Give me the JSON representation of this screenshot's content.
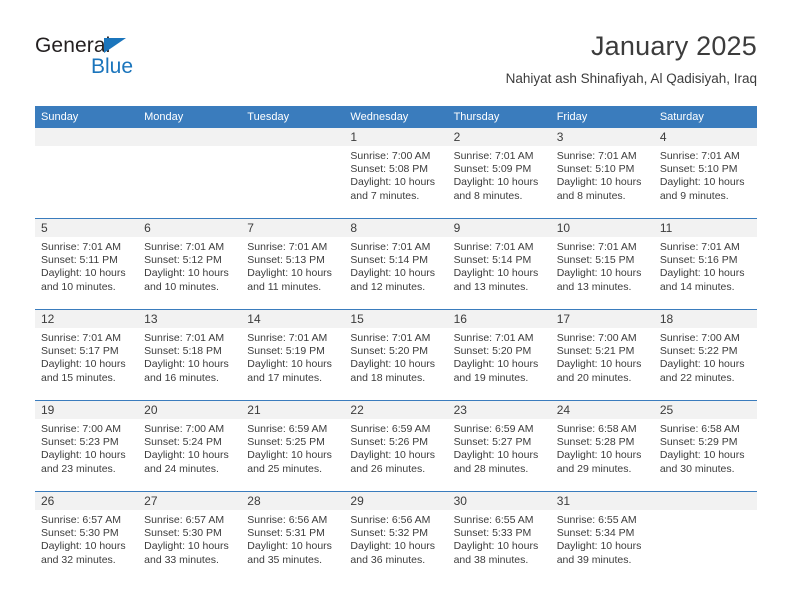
{
  "brand": {
    "name_dark": "General",
    "name_blue": "Blue",
    "accent_color": "#1b75bc"
  },
  "header": {
    "title": "January 2025",
    "subtitle": "Nahiyat ash Shinafiyah, Al Qadisiyah, Iraq"
  },
  "theme": {
    "header_blue": "#3a7cbd",
    "daynum_band": "#f2f2f2",
    "text": "#3c3c3c"
  },
  "weekdays": [
    "Sunday",
    "Monday",
    "Tuesday",
    "Wednesday",
    "Thursday",
    "Friday",
    "Saturday"
  ],
  "weeks": [
    [
      {
        "day": "",
        "sunrise": "",
        "sunset": "",
        "daylight": ""
      },
      {
        "day": "",
        "sunrise": "",
        "sunset": "",
        "daylight": ""
      },
      {
        "day": "",
        "sunrise": "",
        "sunset": "",
        "daylight": ""
      },
      {
        "day": "1",
        "sunrise": "Sunrise: 7:00 AM",
        "sunset": "Sunset: 5:08 PM",
        "daylight": "Daylight: 10 hours and 7 minutes."
      },
      {
        "day": "2",
        "sunrise": "Sunrise: 7:01 AM",
        "sunset": "Sunset: 5:09 PM",
        "daylight": "Daylight: 10 hours and 8 minutes."
      },
      {
        "day": "3",
        "sunrise": "Sunrise: 7:01 AM",
        "sunset": "Sunset: 5:10 PM",
        "daylight": "Daylight: 10 hours and 8 minutes."
      },
      {
        "day": "4",
        "sunrise": "Sunrise: 7:01 AM",
        "sunset": "Sunset: 5:10 PM",
        "daylight": "Daylight: 10 hours and 9 minutes."
      }
    ],
    [
      {
        "day": "5",
        "sunrise": "Sunrise: 7:01 AM",
        "sunset": "Sunset: 5:11 PM",
        "daylight": "Daylight: 10 hours and 10 minutes."
      },
      {
        "day": "6",
        "sunrise": "Sunrise: 7:01 AM",
        "sunset": "Sunset: 5:12 PM",
        "daylight": "Daylight: 10 hours and 10 minutes."
      },
      {
        "day": "7",
        "sunrise": "Sunrise: 7:01 AM",
        "sunset": "Sunset: 5:13 PM",
        "daylight": "Daylight: 10 hours and 11 minutes."
      },
      {
        "day": "8",
        "sunrise": "Sunrise: 7:01 AM",
        "sunset": "Sunset: 5:14 PM",
        "daylight": "Daylight: 10 hours and 12 minutes."
      },
      {
        "day": "9",
        "sunrise": "Sunrise: 7:01 AM",
        "sunset": "Sunset: 5:14 PM",
        "daylight": "Daylight: 10 hours and 13 minutes."
      },
      {
        "day": "10",
        "sunrise": "Sunrise: 7:01 AM",
        "sunset": "Sunset: 5:15 PM",
        "daylight": "Daylight: 10 hours and 13 minutes."
      },
      {
        "day": "11",
        "sunrise": "Sunrise: 7:01 AM",
        "sunset": "Sunset: 5:16 PM",
        "daylight": "Daylight: 10 hours and 14 minutes."
      }
    ],
    [
      {
        "day": "12",
        "sunrise": "Sunrise: 7:01 AM",
        "sunset": "Sunset: 5:17 PM",
        "daylight": "Daylight: 10 hours and 15 minutes."
      },
      {
        "day": "13",
        "sunrise": "Sunrise: 7:01 AM",
        "sunset": "Sunset: 5:18 PM",
        "daylight": "Daylight: 10 hours and 16 minutes."
      },
      {
        "day": "14",
        "sunrise": "Sunrise: 7:01 AM",
        "sunset": "Sunset: 5:19 PM",
        "daylight": "Daylight: 10 hours and 17 minutes."
      },
      {
        "day": "15",
        "sunrise": "Sunrise: 7:01 AM",
        "sunset": "Sunset: 5:20 PM",
        "daylight": "Daylight: 10 hours and 18 minutes."
      },
      {
        "day": "16",
        "sunrise": "Sunrise: 7:01 AM",
        "sunset": "Sunset: 5:20 PM",
        "daylight": "Daylight: 10 hours and 19 minutes."
      },
      {
        "day": "17",
        "sunrise": "Sunrise: 7:00 AM",
        "sunset": "Sunset: 5:21 PM",
        "daylight": "Daylight: 10 hours and 20 minutes."
      },
      {
        "day": "18",
        "sunrise": "Sunrise: 7:00 AM",
        "sunset": "Sunset: 5:22 PM",
        "daylight": "Daylight: 10 hours and 22 minutes."
      }
    ],
    [
      {
        "day": "19",
        "sunrise": "Sunrise: 7:00 AM",
        "sunset": "Sunset: 5:23 PM",
        "daylight": "Daylight: 10 hours and 23 minutes."
      },
      {
        "day": "20",
        "sunrise": "Sunrise: 7:00 AM",
        "sunset": "Sunset: 5:24 PM",
        "daylight": "Daylight: 10 hours and 24 minutes."
      },
      {
        "day": "21",
        "sunrise": "Sunrise: 6:59 AM",
        "sunset": "Sunset: 5:25 PM",
        "daylight": "Daylight: 10 hours and 25 minutes."
      },
      {
        "day": "22",
        "sunrise": "Sunrise: 6:59 AM",
        "sunset": "Sunset: 5:26 PM",
        "daylight": "Daylight: 10 hours and 26 minutes."
      },
      {
        "day": "23",
        "sunrise": "Sunrise: 6:59 AM",
        "sunset": "Sunset: 5:27 PM",
        "daylight": "Daylight: 10 hours and 28 minutes."
      },
      {
        "day": "24",
        "sunrise": "Sunrise: 6:58 AM",
        "sunset": "Sunset: 5:28 PM",
        "daylight": "Daylight: 10 hours and 29 minutes."
      },
      {
        "day": "25",
        "sunrise": "Sunrise: 6:58 AM",
        "sunset": "Sunset: 5:29 PM",
        "daylight": "Daylight: 10 hours and 30 minutes."
      }
    ],
    [
      {
        "day": "26",
        "sunrise": "Sunrise: 6:57 AM",
        "sunset": "Sunset: 5:30 PM",
        "daylight": "Daylight: 10 hours and 32 minutes."
      },
      {
        "day": "27",
        "sunrise": "Sunrise: 6:57 AM",
        "sunset": "Sunset: 5:30 PM",
        "daylight": "Daylight: 10 hours and 33 minutes."
      },
      {
        "day": "28",
        "sunrise": "Sunrise: 6:56 AM",
        "sunset": "Sunset: 5:31 PM",
        "daylight": "Daylight: 10 hours and 35 minutes."
      },
      {
        "day": "29",
        "sunrise": "Sunrise: 6:56 AM",
        "sunset": "Sunset: 5:32 PM",
        "daylight": "Daylight: 10 hours and 36 minutes."
      },
      {
        "day": "30",
        "sunrise": "Sunrise: 6:55 AM",
        "sunset": "Sunset: 5:33 PM",
        "daylight": "Daylight: 10 hours and 38 minutes."
      },
      {
        "day": "31",
        "sunrise": "Sunrise: 6:55 AM",
        "sunset": "Sunset: 5:34 PM",
        "daylight": "Daylight: 10 hours and 39 minutes."
      },
      {
        "day": "",
        "sunrise": "",
        "sunset": "",
        "daylight": ""
      }
    ]
  ]
}
